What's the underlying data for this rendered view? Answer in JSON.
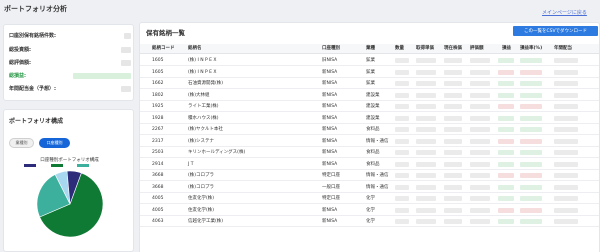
{
  "page": {
    "title": "ポートフォリオ分析",
    "back_link": "メインページに戻る"
  },
  "summary": {
    "rows": [
      {
        "label": "口座別保有銘柄件数:",
        "green": false
      },
      {
        "label": "総投資額:",
        "green": false
      },
      {
        "label": "総評価額:",
        "green": false
      },
      {
        "label": "総損益:",
        "green": true
      },
      {
        "label": "年間配当金（予想）:",
        "green": false
      }
    ]
  },
  "composition": {
    "title": "ポートフォリオ構成",
    "tabs": [
      {
        "label": "業種別",
        "active": false
      },
      {
        "label": "口座種別",
        "active": true
      }
    ],
    "chart_title": "口座種別ポートフォリオ構成",
    "legend_colors": [
      "#2c2c7a",
      "#ffffff",
      "#0f7a33",
      "#ffffff",
      "#3cb09c",
      "#ffffff"
    ],
    "slices": [
      {
        "value": 63,
        "color": "#0f7a33"
      },
      {
        "value": 24,
        "color": "#3cb09c"
      },
      {
        "value": 6,
        "color": "#a8d8ef"
      },
      {
        "value": 7,
        "color": "#2c2c7a"
      }
    ]
  },
  "holdings": {
    "title": "保有銘柄一覧",
    "csv_button": "この一覧をCSVでダウンロード",
    "columns": [
      "銘柄コード",
      "銘柄名",
      "口座種別",
      "業種",
      "数量",
      "取得単価",
      "現在株価",
      "評価額",
      "損益",
      "損益率(%)",
      "年間配当"
    ],
    "rows": [
      {
        "code": "1605",
        "name": "(株) I N P E X",
        "account": "旧NISA",
        "sector": "鉱業"
      },
      {
        "code": "1605",
        "name": "(株) I N P E X",
        "account": "新NISA",
        "sector": "鉱業"
      },
      {
        "code": "1662",
        "name": "石油資源開発(株)",
        "account": "新NISA",
        "sector": "鉱業"
      },
      {
        "code": "1802",
        "name": "(株)大林組",
        "account": "新NISA",
        "sector": "建設業"
      },
      {
        "code": "1925",
        "name": "ライト工業(株)",
        "account": "新NISA",
        "sector": "建設業"
      },
      {
        "code": "1928",
        "name": "積水ハウス(株)",
        "account": "新NISA",
        "sector": "建設業"
      },
      {
        "code": "2267",
        "name": "(株)ヤクルト本社",
        "account": "新NISA",
        "sector": "食料品"
      },
      {
        "code": "2317",
        "name": "(株)システナ",
        "account": "新NISA",
        "sector": "情報・通信"
      },
      {
        "code": "2503",
        "name": "キリンホールディングス(株)",
        "account": "新NISA",
        "sector": "食料品"
      },
      {
        "code": "2914",
        "name": "J T",
        "account": "新NISA",
        "sector": "食料品"
      },
      {
        "code": "3668",
        "name": "(株)コロプラ",
        "account": "特定口座",
        "sector": "情報・通信"
      },
      {
        "code": "3668",
        "name": "(株)コロプラ",
        "account": "一般口座",
        "sector": "情報・通信"
      },
      {
        "code": "4005",
        "name": "住友化学(株)",
        "account": "特定口座",
        "sector": "化学"
      },
      {
        "code": "4005",
        "name": "住友化学(株)",
        "account": "新NISA",
        "sector": "化学"
      },
      {
        "code": "4063",
        "name": "信越化学工業(株)",
        "account": "新NISA",
        "sector": "化学"
      }
    ]
  }
}
